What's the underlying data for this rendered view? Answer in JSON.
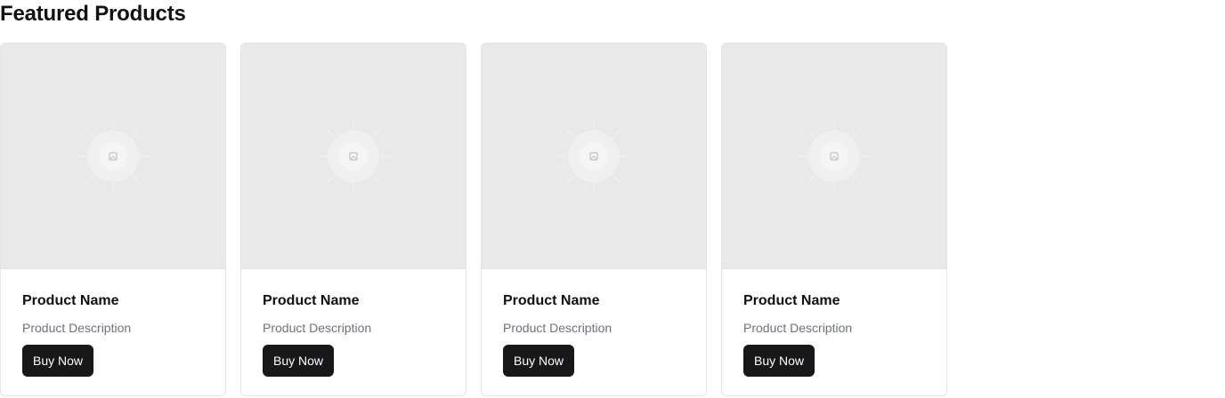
{
  "section": {
    "title": "Featured Products"
  },
  "products": [
    {
      "name": "Product Name",
      "description": "Product Description",
      "button_label": "Buy Now",
      "image_icon": "image-placeholder-icon"
    },
    {
      "name": "Product Name",
      "description": "Product Description",
      "button_label": "Buy Now",
      "image_icon": "image-placeholder-icon"
    },
    {
      "name": "Product Name",
      "description": "Product Description",
      "button_label": "Buy Now",
      "image_icon": "image-placeholder-icon"
    },
    {
      "name": "Product Name",
      "description": "Product Description",
      "button_label": "Buy Now",
      "image_icon": "image-placeholder-icon"
    }
  ],
  "colors": {
    "button_bg": "#18181b",
    "button_text": "#ffffff",
    "image_bg": "#e9e9e9",
    "description_text": "#6b7280"
  }
}
